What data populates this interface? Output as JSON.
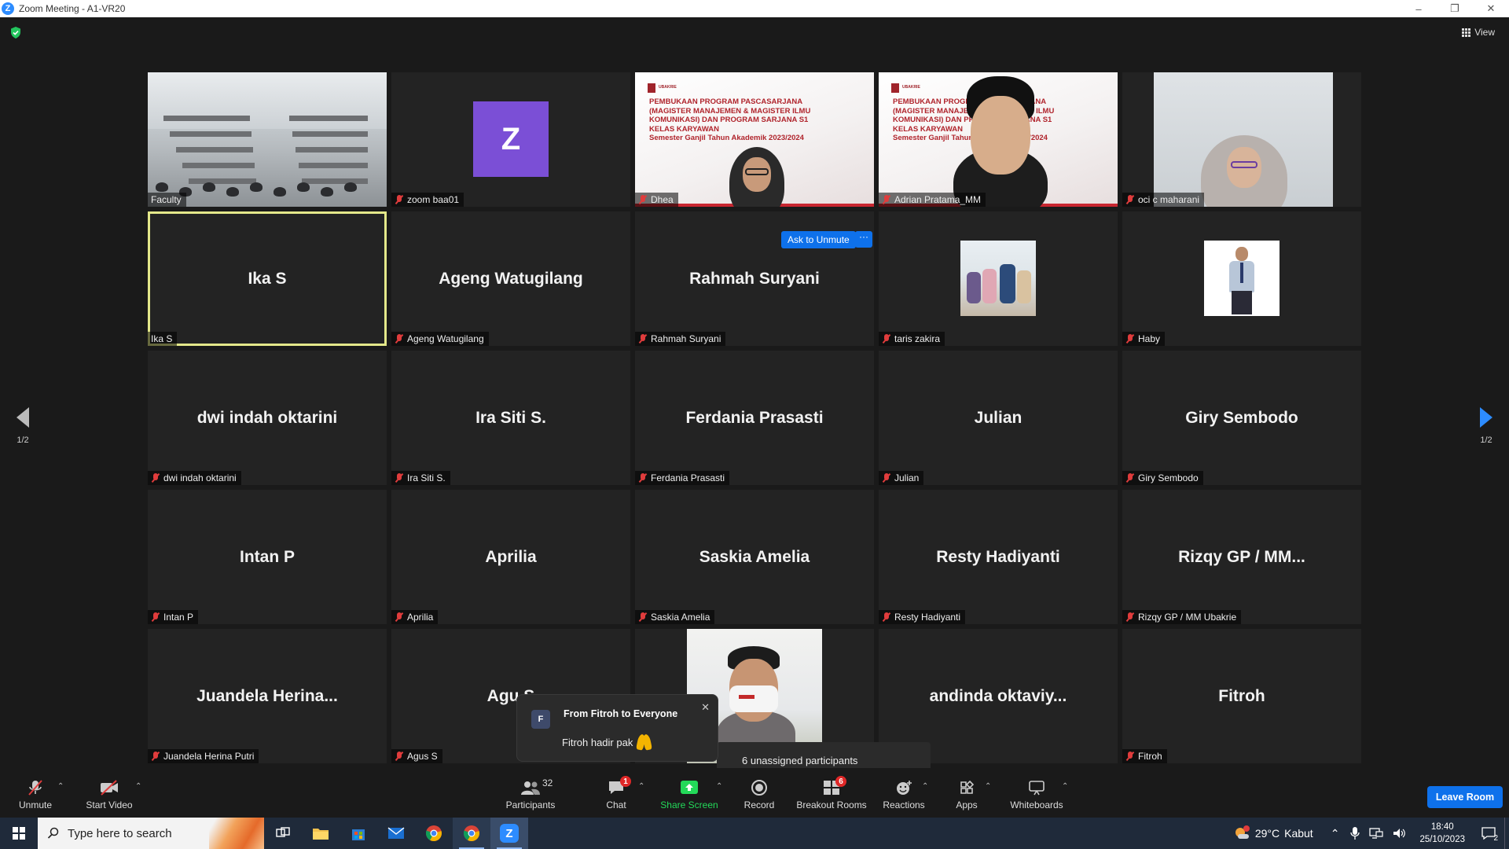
{
  "window": {
    "title": "Zoom Meeting - A1-VR20",
    "minimize": "–",
    "restore": "❐",
    "close": "✕"
  },
  "view_label": "View",
  "pager": {
    "left": "1/2",
    "right": "1/2"
  },
  "tiles": [
    {
      "name": "Faculty",
      "label": "Faculty",
      "muted": false,
      "kind": "classroom"
    },
    {
      "name": "zoom baa01",
      "label": "zoom baa01",
      "muted": true,
      "kind": "avatar",
      "avatar_letter": "Z",
      "avatar_color": "#7b4fd6"
    },
    {
      "name": "Dhea",
      "label": "Dhea",
      "muted": true,
      "kind": "slide"
    },
    {
      "name": "Adrian Pratama_MM",
      "label": "Adrian Pratama_MM",
      "muted": true,
      "kind": "slide-person"
    },
    {
      "name": "oci c maharani",
      "label": "oci c maharani",
      "muted": true,
      "kind": "person"
    },
    {
      "name": "Ika S",
      "label": "Ika S",
      "muted": false,
      "kind": "name",
      "active": true
    },
    {
      "name": "Ageng Watugilang",
      "label": "Ageng Watugilang",
      "muted": true,
      "kind": "name"
    },
    {
      "name": "Rahmah Suryani",
      "label": "Rahmah Suryani",
      "muted": true,
      "kind": "name"
    },
    {
      "name": "taris zakira",
      "label": "taris zakira",
      "muted": true,
      "kind": "photo-group"
    },
    {
      "name": "Haby",
      "label": "Haby",
      "muted": true,
      "kind": "photo-man"
    },
    {
      "name": "dwi indah oktarini",
      "label": "dwi indah oktarini",
      "muted": true,
      "kind": "name"
    },
    {
      "name": "Ira Siti S.",
      "label": "Ira Siti S.",
      "muted": true,
      "kind": "name"
    },
    {
      "name": "Ferdania Prasasti",
      "label": "Ferdania Prasasti",
      "muted": true,
      "kind": "name"
    },
    {
      "name": "Julian",
      "label": "Julian",
      "muted": true,
      "kind": "name"
    },
    {
      "name": "Giry Sembodo",
      "label": "Giry Sembodo",
      "muted": true,
      "kind": "name"
    },
    {
      "name": "Intan P",
      "label": "Intan P",
      "muted": true,
      "kind": "name"
    },
    {
      "name": "Aprilia",
      "label": "Aprilia",
      "muted": true,
      "kind": "name"
    },
    {
      "name": "Saskia Amelia",
      "label": "Saskia Amelia",
      "muted": true,
      "kind": "name"
    },
    {
      "name": "Resty Hadiyanti",
      "label": "Resty Hadiyanti",
      "muted": true,
      "kind": "name"
    },
    {
      "name": "Rizqy GP / MM...",
      "label": "Rizqy GP / MM Ubakrie",
      "muted": true,
      "kind": "name"
    },
    {
      "name": "Juandela  Herina...",
      "label": "Juandela Herina Putri",
      "muted": true,
      "kind": "name"
    },
    {
      "name": "Agu  S",
      "label": "Agus S",
      "muted": true,
      "kind": "name"
    },
    {
      "name": "",
      "label": "",
      "muted": false,
      "kind": "photo-mask"
    },
    {
      "name": "andinda  oktaviy...",
      "label": "oktaviyani",
      "muted": false,
      "kind": "name"
    },
    {
      "name": "Fitroh",
      "label": "Fitroh",
      "muted": true,
      "kind": "name"
    }
  ],
  "slide": {
    "logo_text": "UBAKRIE",
    "lines": [
      "PEMBUKAAN PROGRAM PASCASARJANA",
      "(MAGISTER MANAJEMEN & MAGISTER ILMU",
      "KOMUNIKASI) DAN PROGRAM SARJANA S1",
      "KELAS KARYAWAN",
      "Semester Ganjil Tahun Akademik 2023/2024"
    ]
  },
  "ask_to_unmute": "Ask to Unmute",
  "more_label": "···",
  "chat_popup": {
    "avatar": "F",
    "from": "From Fitroh to Everyone",
    "message": "Fitroh hadir pak",
    "close": "✕"
  },
  "unassigned": "6 unassigned participants",
  "toolbar": {
    "unmute": "Unmute",
    "start_video": "Start Video",
    "participants": "Participants",
    "participants_count": "32",
    "chat": "Chat",
    "chat_badge": "1",
    "share_screen": "Share Screen",
    "record": "Record",
    "breakout_rooms": "Breakout Rooms",
    "breakout_badge": "6",
    "reactions": "Reactions",
    "apps": "Apps",
    "whiteboards": "Whiteboards",
    "leave": "Leave Room",
    "share_color": "#23d959"
  },
  "taskbar": {
    "search_placeholder": "Type here to search",
    "weather_temp": "29°C",
    "weather_text": "Kabut",
    "time": "18:40",
    "date": "25/10/2023",
    "notification_count": "2"
  }
}
